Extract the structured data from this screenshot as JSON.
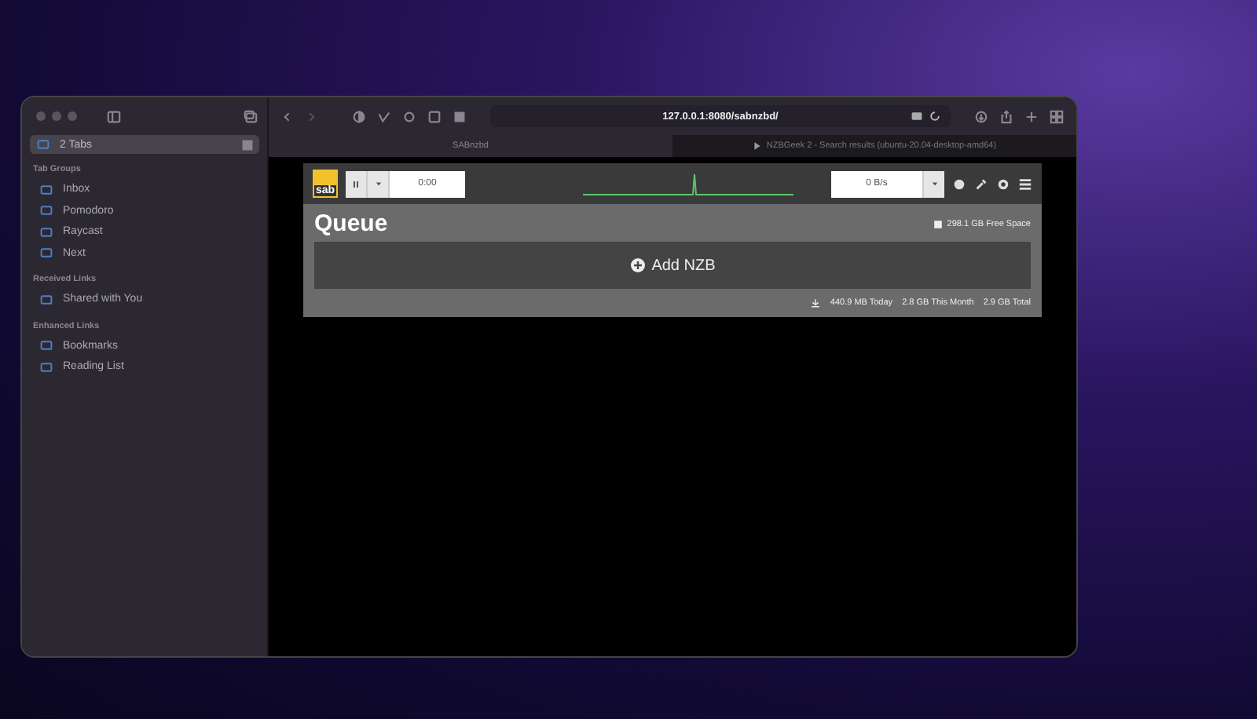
{
  "sidebar": {
    "tab_item": {
      "label": "2 Tabs",
      "selected": true
    },
    "sections": [
      {
        "heading": "Tab Groups",
        "items": [
          {
            "label": "Inbox"
          },
          {
            "label": "Pomodoro"
          },
          {
            "label": "Raycast"
          },
          {
            "label": "Next"
          }
        ]
      },
      {
        "heading": "Received Links",
        "items": [
          {
            "label": "Shared with You"
          }
        ]
      },
      {
        "heading": "Enhanced Links",
        "items": [
          {
            "label": "Bookmarks"
          },
          {
            "label": "Reading List"
          }
        ]
      }
    ]
  },
  "toolbar": {
    "address": "127.0.0.1:8080/sabnzbd/"
  },
  "tabs": [
    {
      "label": "SABnzbd",
      "selected": true
    },
    {
      "label": "NZBGeek 2 - Search results (ubuntu-20.04-desktop-amd64)",
      "selected": false
    }
  ],
  "sab": {
    "logo": "sab",
    "timer": "0:00",
    "speed": "0 B/s",
    "title": "Queue",
    "free_space": "298.1 GB Free Space",
    "add_button": "Add NZB",
    "stats": [
      "440.9 MB Today",
      "2.8 GB This Month",
      "2.9 GB Total"
    ]
  }
}
